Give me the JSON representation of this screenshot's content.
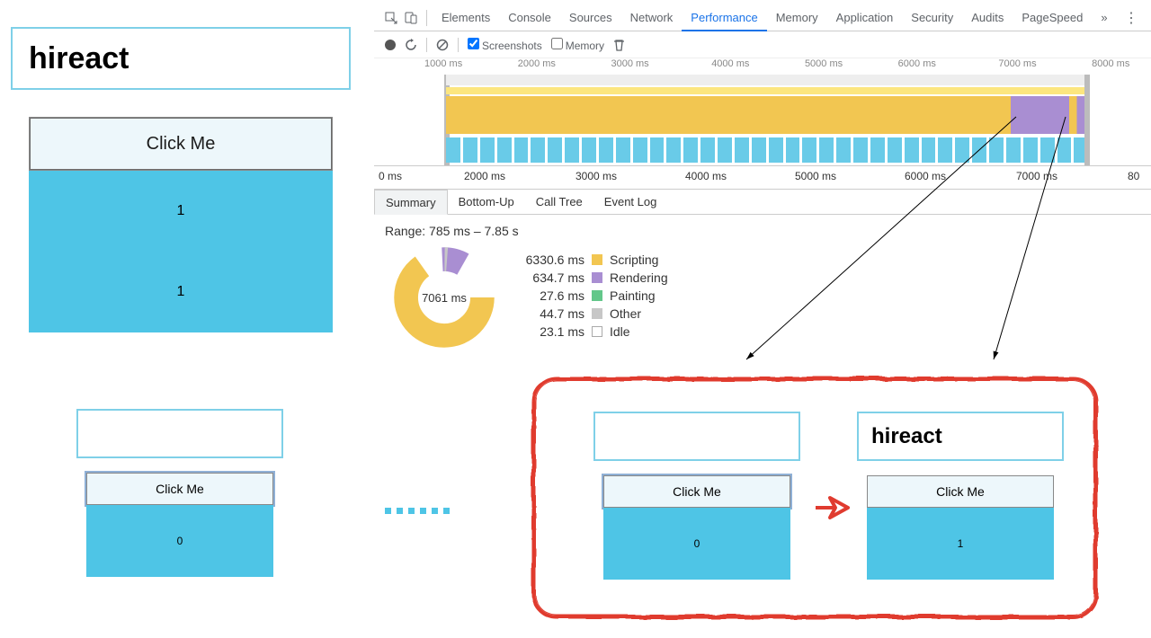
{
  "app_big": {
    "input_value": "hireact",
    "button_label": "Click Me",
    "panel_numbers": [
      "1",
      "1"
    ]
  },
  "state1": {
    "input_value": "",
    "button_label": "Click Me",
    "panel_number": "0"
  },
  "state2": {
    "input_value": "",
    "button_label": "Click Me",
    "panel_number": "0"
  },
  "state3": {
    "input_value": "hireact",
    "button_label": "Click Me",
    "panel_number": "1"
  },
  "devtools": {
    "tabs": [
      "Elements",
      "Console",
      "Sources",
      "Network",
      "Performance",
      "Memory",
      "Application",
      "Security",
      "Audits",
      "PageSpeed"
    ],
    "active_tab": "Performance",
    "more_symbol": "»",
    "controls": {
      "screenshots_label": "Screenshots",
      "memory_label": "Memory"
    },
    "overview_marks": [
      "1000 ms",
      "2000 ms",
      "3000 ms",
      "4000 ms",
      "5000 ms",
      "6000 ms",
      "7000 ms",
      "8000 ms"
    ],
    "ruler2_marks": [
      "0 ms",
      "2000 ms",
      "3000 ms",
      "4000 ms",
      "5000 ms",
      "6000 ms",
      "7000 ms",
      "80"
    ],
    "detail_tabs": [
      "Summary",
      "Bottom-Up",
      "Call Tree",
      "Event Log"
    ],
    "range_text": "Range: 785 ms – 7.85 s",
    "donut_center": "7061 ms",
    "legend": [
      {
        "ms": "6330.6 ms",
        "color": "#f2c651",
        "label": "Scripting"
      },
      {
        "ms": "634.7 ms",
        "color": "#a98ed2",
        "label": "Rendering"
      },
      {
        "ms": "27.6 ms",
        "color": "#63c78a",
        "label": "Painting"
      },
      {
        "ms": "44.7 ms",
        "color": "#c7c7c7",
        "label": "Other"
      },
      {
        "ms": "23.1 ms",
        "color": "#ffffff",
        "label": "Idle"
      }
    ]
  },
  "chart_data": {
    "type": "pie",
    "title": "Performance summary",
    "total_label": "7061 ms",
    "series": [
      {
        "name": "Scripting",
        "value": 6330.6,
        "color": "#f2c651"
      },
      {
        "name": "Rendering",
        "value": 634.7,
        "color": "#a98ed2"
      },
      {
        "name": "Painting",
        "value": 27.6,
        "color": "#63c78a"
      },
      {
        "name": "Other",
        "value": 44.7,
        "color": "#c7c7c7"
      },
      {
        "name": "Idle",
        "value": 23.1,
        "color": "#ffffff"
      }
    ],
    "range": "785 ms – 7.85 s"
  }
}
